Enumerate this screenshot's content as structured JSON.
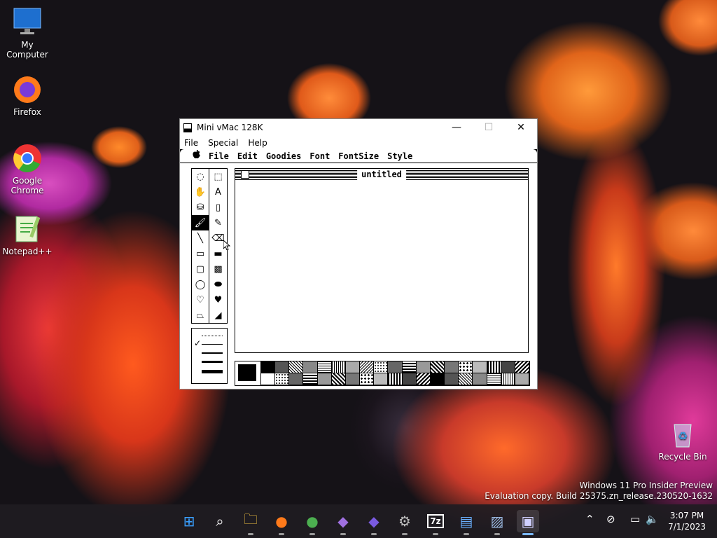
{
  "desktop": {
    "icons": [
      {
        "label": "My Computer"
      },
      {
        "label": "Firefox"
      },
      {
        "label": "Google Chrome"
      },
      {
        "label": "Notepad++"
      },
      {
        "label": "Recycle Bin"
      }
    ],
    "watermark": {
      "line1": "Windows 11 Pro Insider Preview",
      "line2": "Evaluation copy. Build 25375.zn_release.230520-1632"
    }
  },
  "window": {
    "title": "Mini vMac 128K",
    "menu": [
      "File",
      "Special",
      "Help"
    ],
    "controls": {
      "minimize": "—",
      "maximize": "☐",
      "close": "✕"
    }
  },
  "mac": {
    "menu": {
      "apple": "",
      "items": [
        "File",
        "Edit",
        "Goodies",
        "Font",
        "FontSize",
        "Style"
      ]
    },
    "document_title": "untitled",
    "tools": [
      {
        "name": "lasso",
        "glyph": "◌"
      },
      {
        "name": "marquee",
        "glyph": "⬚"
      },
      {
        "name": "grabber",
        "glyph": "✋"
      },
      {
        "name": "text",
        "glyph": "A"
      },
      {
        "name": "paint-bucket",
        "glyph": "⛁"
      },
      {
        "name": "spray-can",
        "glyph": "▯"
      },
      {
        "name": "paintbrush",
        "glyph": "🖌"
      },
      {
        "name": "pencil",
        "glyph": "✎"
      },
      {
        "name": "line",
        "glyph": "╲"
      },
      {
        "name": "eraser",
        "glyph": "⌫"
      },
      {
        "name": "rectangle",
        "glyph": "▭"
      },
      {
        "name": "filled-rectangle",
        "glyph": "▬"
      },
      {
        "name": "rounded-rectangle",
        "glyph": "▢"
      },
      {
        "name": "filled-rounded-rectangle",
        "glyph": "▩"
      },
      {
        "name": "oval",
        "glyph": "◯"
      },
      {
        "name": "filled-oval",
        "glyph": "⬬"
      },
      {
        "name": "freeform",
        "glyph": "♡"
      },
      {
        "name": "filled-freeform",
        "glyph": "♥"
      },
      {
        "name": "polygon",
        "glyph": "⏢"
      },
      {
        "name": "filled-polygon",
        "glyph": "◢"
      }
    ],
    "selected_tool": "paintbrush",
    "line_check": "✓"
  },
  "taskbar": {
    "apps": [
      {
        "name": "start",
        "glyph": "⊞",
        "color": "#3aa0ff"
      },
      {
        "name": "search",
        "glyph": "⌕",
        "color": "#ffffff"
      },
      {
        "name": "file-explorer",
        "glyph": "🗀",
        "color": "#f5c542"
      },
      {
        "name": "firefox",
        "glyph": "●",
        "color": "#ff7a1a"
      },
      {
        "name": "chrome",
        "glyph": "●",
        "color": "#4caf50"
      },
      {
        "name": "visual-studio",
        "glyph": "◆",
        "color": "#a070e0"
      },
      {
        "name": "visual-studio-2",
        "glyph": "◆",
        "color": "#7a5ae0"
      },
      {
        "name": "settings",
        "glyph": "⚙",
        "color": "#c0c0c0"
      },
      {
        "name": "7zip",
        "glyph": "7z",
        "color": "#ffffff"
      },
      {
        "name": "notepad",
        "glyph": "▤",
        "color": "#6ab0ff"
      },
      {
        "name": "photos",
        "glyph": "▨",
        "color": "#9ab8e0"
      },
      {
        "name": "mini-vmac",
        "glyph": "▣",
        "color": "#d0d0ff"
      }
    ],
    "time": "3:07 PM",
    "date": "7/1/2023"
  }
}
